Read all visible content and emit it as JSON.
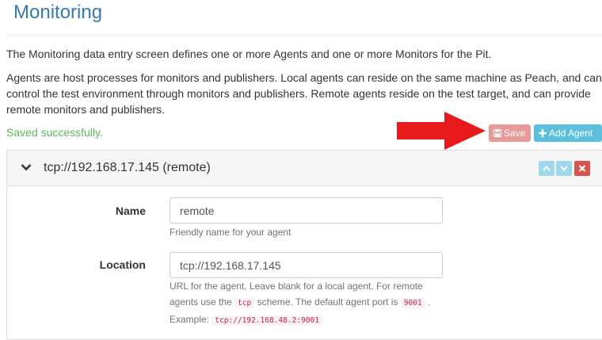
{
  "page": {
    "title": "Monitoring",
    "intro_1": "The Monitoring data entry screen defines one or more Agents and one or more Monitors for the Pit.",
    "intro_2": "Agents are host processes for monitors and publishers. Local agents can reside on the same machine as Peach, and can control the test environment through monitors and publishers. Remote agents reside on the test target, and can provide remote monitors and publishers.",
    "status_message": "Saved successfully."
  },
  "toolbar": {
    "save_label": "Save",
    "add_agent_label": "Add Agent"
  },
  "agent_panel": {
    "title": "tcp://192.168.17.145 (remote)",
    "fields": {
      "name_label": "Name",
      "name_value": "remote",
      "name_help": "Friendly name for your agent",
      "location_label": "Location",
      "location_value": "tcp://192.168.17.145",
      "location_help_1": "URL for the agent. Leave blank for a local agent. For remote agents use the ",
      "location_help_code_1": "tcp",
      "location_help_2": " scheme. The default agent port is ",
      "location_help_code_2": "9001",
      "location_help_3": " . Example: ",
      "location_help_code_3": "tcp://192.168.48.2:9001"
    }
  },
  "colors": {
    "title": "#337ab7",
    "success": "#5cb85c",
    "save_button": "#e89a9a",
    "add_button": "#5bc0de",
    "move_buttons": "#9fd8ec",
    "delete_button": "#d9534f",
    "annotation_arrow": "#e8191b",
    "code_text": "#c7254e"
  },
  "icons": {
    "save": "floppy-disk-icon",
    "add": "plus-icon",
    "expand": "chevron-down-icon",
    "move_up": "chevron-up-icon",
    "move_down": "chevron-down-icon",
    "delete": "close-icon",
    "annotation": "red-arrow-icon"
  }
}
